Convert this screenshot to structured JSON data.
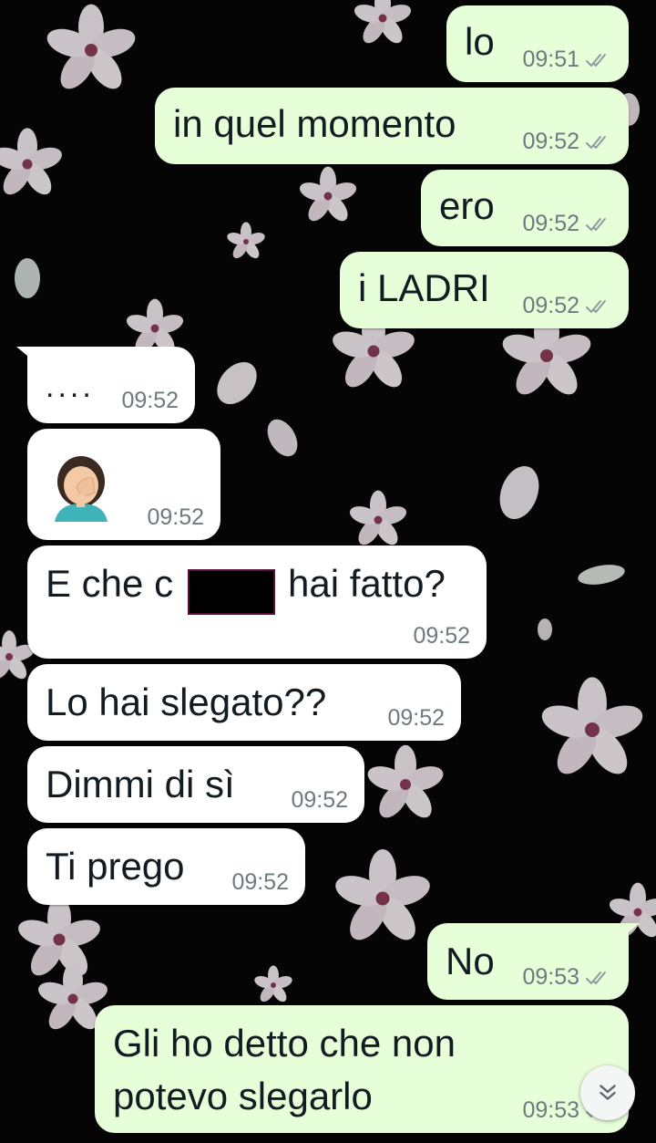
{
  "messages": [
    {
      "id": "m1",
      "direction": "outgoing",
      "text": "lo",
      "time": "09:51",
      "status": "read"
    },
    {
      "id": "m2",
      "direction": "outgoing",
      "text": "in quel momento",
      "time": "09:52",
      "status": "read"
    },
    {
      "id": "m3",
      "direction": "outgoing",
      "text": "ero",
      "time": "09:52",
      "status": "read"
    },
    {
      "id": "m4",
      "direction": "outgoing",
      "text": "i LADRI",
      "time": "09:52",
      "status": "read"
    },
    {
      "id": "m5",
      "direction": "incoming",
      "text": "....",
      "time": "09:52"
    },
    {
      "id": "m6",
      "direction": "incoming",
      "emoji": "face-palm",
      "time": "09:52"
    },
    {
      "id": "m7",
      "direction": "incoming",
      "text_before": "E che c",
      "text_after": "hai fatto?",
      "redacted": true,
      "time": "09:52"
    },
    {
      "id": "m8",
      "direction": "incoming",
      "text": "Lo hai slegato??",
      "time": "09:52"
    },
    {
      "id": "m9",
      "direction": "incoming",
      "text": "Dimmi di sì",
      "time": "09:52"
    },
    {
      "id": "m10",
      "direction": "incoming",
      "text": "Ti prego",
      "time": "09:52"
    },
    {
      "id": "m11",
      "direction": "outgoing",
      "text": "No",
      "time": "09:53",
      "status": "read"
    },
    {
      "id": "m12",
      "direction": "outgoing",
      "lines": [
        "Gli ho detto che non",
        "potevo slegarlo"
      ],
      "time": "09:53",
      "status": "read"
    }
  ],
  "colors": {
    "outgoing_bubble": "#e6ffd9",
    "incoming_bubble": "#ffffff",
    "read_ticks": "#8f9aa0",
    "wallpaper": "#050505"
  },
  "icons": {
    "scroll_down": "double-chevron-down-icon",
    "read_receipt": "double-check-icon"
  }
}
